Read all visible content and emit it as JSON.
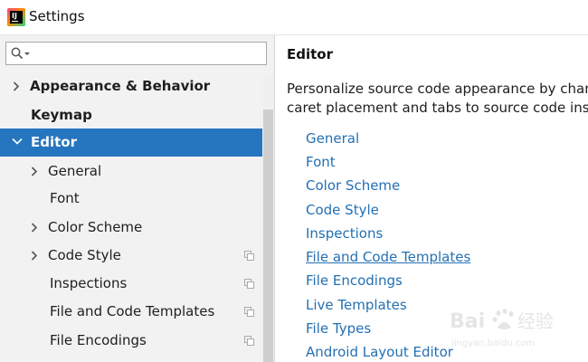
{
  "window": {
    "title": "Settings"
  },
  "search": {
    "value": ""
  },
  "sidebar": {
    "items": [
      {
        "label": "Appearance & Behavior"
      },
      {
        "label": "Keymap"
      },
      {
        "label": "Editor"
      },
      {
        "label": "General"
      },
      {
        "label": "Font"
      },
      {
        "label": "Color Scheme"
      },
      {
        "label": "Code Style"
      },
      {
        "label": "Inspections"
      },
      {
        "label": "File and Code Templates"
      },
      {
        "label": "File Encodings"
      }
    ]
  },
  "main": {
    "title": "Editor",
    "description_line1": "Personalize source code appearance by changi",
    "description_line2": "caret placement and tabs to source code inspe",
    "links": [
      {
        "label": "General"
      },
      {
        "label": "Font"
      },
      {
        "label": "Color Scheme"
      },
      {
        "label": "Code Style"
      },
      {
        "label": "Inspections"
      },
      {
        "label": "File and Code Templates"
      },
      {
        "label": "File Encodings"
      },
      {
        "label": "Live Templates"
      },
      {
        "label": "File Types"
      },
      {
        "label": "Android Layout Editor"
      }
    ]
  },
  "watermark": {
    "text": "Bai",
    "text2": "经验",
    "url": "jingyan.baidu.com"
  },
  "colors": {
    "selection": "#2675bf",
    "link": "#2470b3",
    "sidebar_bg": "#f2f2f2"
  }
}
